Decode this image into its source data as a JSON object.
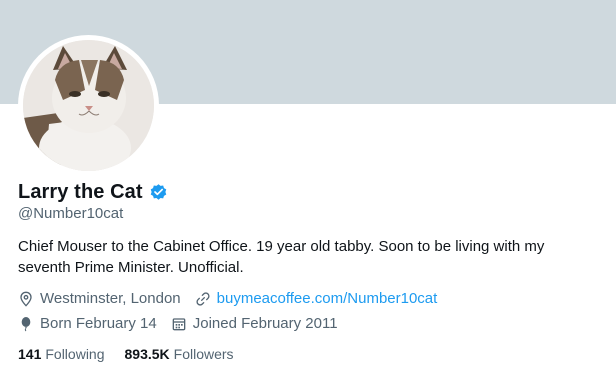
{
  "profile": {
    "name": "Larry the Cat",
    "handle": "@Number10cat",
    "bio_line1": "Chief Mouser to the Cabinet Office. 19 year old tabby. Soon to be living with my",
    "bio_line2": "seventh Prime Minister. Unofficial.",
    "location": "Westminster, London",
    "website": "buymeacoffee.com/Number10cat",
    "birthday": "Born February 14",
    "joined": "Joined February 2011",
    "following_count": "141",
    "following_label": "Following",
    "followers_count": "893.5K",
    "followers_label": "Followers"
  },
  "icons": {
    "verified": "verified-badge-icon",
    "location": "location-icon",
    "link": "link-icon",
    "birthday": "balloon-icon",
    "joined": "calendar-icon"
  },
  "colors": {
    "banner": "#cfd9de",
    "link": "#1d9bf0",
    "secondary_text": "#536471",
    "verified": "#1d9bf0"
  }
}
